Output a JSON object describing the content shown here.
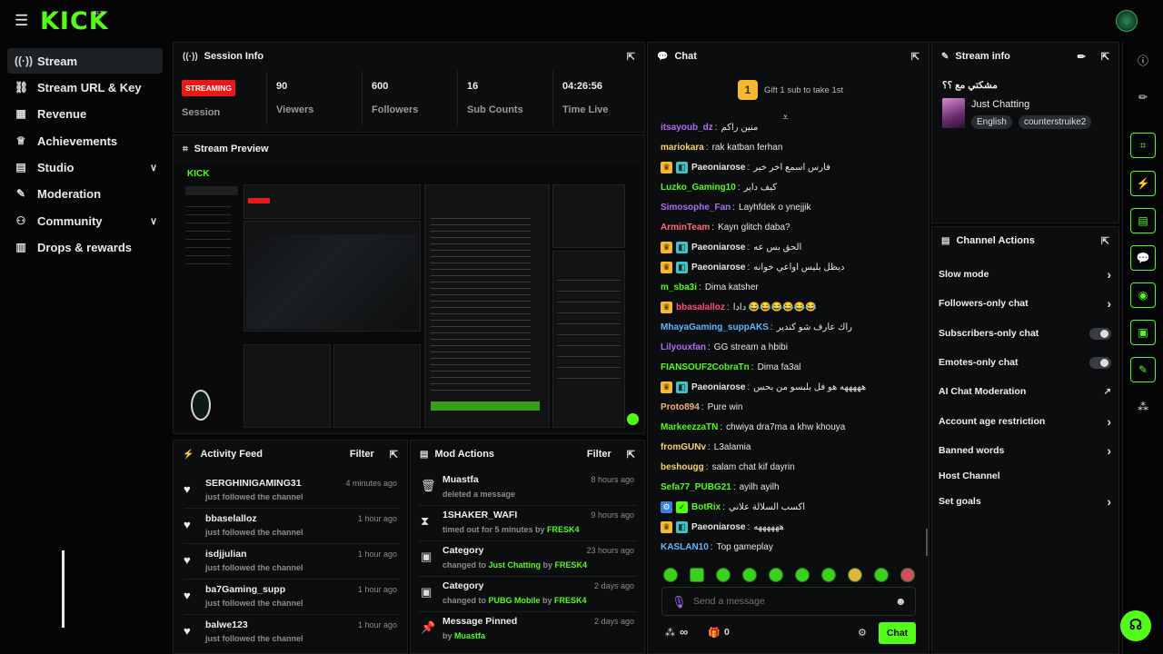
{
  "topbar": {
    "logo": "KICK",
    "beta": "BETA"
  },
  "sidebar": {
    "items": [
      {
        "label": "Stream",
        "icon": "broadcast-icon",
        "glyph": "((·))"
      },
      {
        "label": "Stream URL & Key",
        "icon": "link-icon",
        "glyph": "🔗"
      },
      {
        "label": "Revenue",
        "icon": "chart-icon",
        "glyph": "▦"
      },
      {
        "label": "Achievements",
        "icon": "trophy-icon",
        "glyph": "🏆"
      },
      {
        "label": "Studio",
        "icon": "studio-icon",
        "glyph": "▤"
      },
      {
        "label": "Moderation",
        "icon": "wrench-icon",
        "glyph": "🔧"
      },
      {
        "label": "Community",
        "icon": "people-icon",
        "glyph": "👥"
      },
      {
        "label": "Drops & rewards",
        "icon": "gift-icon",
        "glyph": "▥"
      }
    ]
  },
  "session": {
    "title": "Session Info",
    "status": "STREAMING",
    "session_label": "Session",
    "stats": [
      {
        "value": "90",
        "label": "Viewers"
      },
      {
        "value": "600",
        "label": "Followers"
      },
      {
        "value": "16",
        "label": "Sub Counts"
      },
      {
        "value": "04:26:56",
        "label": "Time Live"
      }
    ]
  },
  "preview": {
    "title": "Stream Preview"
  },
  "activity": {
    "title": "Activity Feed",
    "filter": "Filter",
    "items": [
      {
        "name": "SERGHINIGAMING31",
        "sub": "just followed the channel",
        "time": "4 minutes ago"
      },
      {
        "name": "bbaselalloz",
        "sub": "just followed the channel",
        "time": "1 hour ago"
      },
      {
        "name": "isdjjulian",
        "sub": "just followed the channel",
        "time": "1 hour ago"
      },
      {
        "name": "ba7Gaming_supp",
        "sub": "just followed the channel",
        "time": "1 hour ago"
      },
      {
        "name": "balwe123",
        "sub": "just followed the channel",
        "time": "1 hour ago"
      }
    ]
  },
  "mod": {
    "title": "Mod Actions",
    "filter": "Filter",
    "items": [
      {
        "name": "Muastfa",
        "pre": "deleted a message",
        "hl": "",
        "mid": "",
        "by": "",
        "time": "8 hours ago",
        "icon": "trash-icon",
        "glyph": "🗑"
      },
      {
        "name": "1SHAKER_WAFI",
        "pre": "timed out for 5 minutes by ",
        "hl": "FRESK4",
        "mid": "",
        "by": "",
        "time": "9 hours ago",
        "icon": "hourglass-icon",
        "glyph": "⌛"
      },
      {
        "name": "Category",
        "pre": "changed to ",
        "hl": "Just Chatting",
        "mid": " by ",
        "by": "FRESK4",
        "time": "23 hours ago",
        "icon": "category-icon",
        "glyph": "▣"
      },
      {
        "name": "Category",
        "pre": "changed to ",
        "hl": "PUBG Mobile",
        "mid": " by ",
        "by": "FRESK4",
        "time": "2 days ago",
        "icon": "category-icon",
        "glyph": "▣"
      },
      {
        "name": "Message Pinned",
        "pre": "by ",
        "hl": "Muastfa",
        "mid": "",
        "by": "",
        "time": "2 days ago",
        "icon": "pin-icon",
        "glyph": "📌"
      }
    ]
  },
  "chat": {
    "title": "Chat",
    "gift_count": "1",
    "gift_text": "Gift 1 sub to take 1st",
    "messages": [
      {
        "user": "itsayoub_dz",
        "color": "#b06cf5",
        "text": "منين راكم",
        "badges": []
      },
      {
        "user": "mariokara",
        "color": "#f5d36c",
        "text": "rak katban ferhan",
        "badges": []
      },
      {
        "user": "Paeoniarose",
        "color": "#e6e6e6",
        "text": "فارس اسمع اخر خبر",
        "badges": [
          "crown",
          "sub"
        ]
      },
      {
        "user": "Luzko_Gaming10",
        "color": "#53fc18",
        "text": "كيف داير",
        "badges": []
      },
      {
        "user": "Simosophe_Fan",
        "color": "#b06cf5",
        "text": "Layhfdek o ynejjik",
        "badges": []
      },
      {
        "user": "ArminTeam",
        "color": "#ff6b7a",
        "text": "Kayn glitch daba?",
        "badges": []
      },
      {
        "user": "Paeoniarose",
        "color": "#e6e6e6",
        "text": "الحق بس عه",
        "badges": [
          "crown",
          "sub"
        ]
      },
      {
        "user": "Paeoniarose",
        "color": "#e6e6e6",
        "text": "ديظل بليس اواعي خوانه",
        "badges": [
          "crown",
          "sub"
        ]
      },
      {
        "user": "m_sba3i",
        "color": "#53fc18",
        "text": "Dima katsher",
        "badges": []
      },
      {
        "user": "bbasalalloz",
        "color": "#ff4d7e",
        "text": "دادا 😂😂😂😂😂😂",
        "badges": [
          "crown"
        ]
      },
      {
        "user": "MhayaGaming_suppAKS",
        "color": "#5fb8ff",
        "text": "راك عارف شو كندير",
        "badges": []
      },
      {
        "user": "Lilyouxfan",
        "color": "#b06cf5",
        "text": "GG stream a hbibi",
        "badges": []
      },
      {
        "user": "FIANSOUF2CobraTn",
        "color": "#53fc18",
        "text": "Dima fa3al",
        "badges": []
      },
      {
        "user": "Paeoniarose",
        "color": "#e6e6e6",
        "text": "هههههه هو فل بلبسو من بحس",
        "badges": [
          "crown",
          "sub"
        ]
      },
      {
        "user": "Proto894",
        "color": "#f5b36c",
        "text": "Pure win",
        "badges": []
      },
      {
        "user": "MarkeezzaTN",
        "color": "#53fc18",
        "text": "chwiya dra7ma a khw khouya",
        "badges": []
      },
      {
        "user": "fromGUNv",
        "color": "#f5d36c",
        "text": "L3alamia",
        "badges": []
      },
      {
        "user": "beshougg",
        "color": "#f5d36c",
        "text": "salam chat kif dayrin",
        "badges": []
      },
      {
        "user": "Sefa77_PUBG21",
        "color": "#53fc18",
        "text": "ayilh ayilh",
        "badges": []
      },
      {
        "user": "BotRix",
        "color": "#53fc18",
        "text": "اكسب السلالة علاني",
        "badges": [
          "bot",
          "verified"
        ]
      },
      {
        "user": "Paeoniarose",
        "color": "#e6e6e6",
        "text": "ههههههه",
        "badges": [
          "crown",
          "sub"
        ]
      },
      {
        "user": "KASLAN10",
        "color": "#5fb8ff",
        "text": "Top gameplay",
        "badges": []
      }
    ],
    "placeholder": "Send a message",
    "points": "∞",
    "gift_inventory": "0",
    "send_label": "Chat"
  },
  "stream_info": {
    "title": "Stream info",
    "stream_title": "مشكتي مع ؟؟",
    "category": "Just Chatting",
    "tags": [
      "English",
      "counterstruike2"
    ]
  },
  "channel_actions": {
    "title": "Channel Actions",
    "items": [
      {
        "label": "Slow mode",
        "kind": "chevron"
      },
      {
        "label": "Followers-only chat",
        "kind": "chevron"
      },
      {
        "label": "Subscribers-only chat",
        "kind": "toggle"
      },
      {
        "label": "Emotes-only chat",
        "kind": "toggle"
      },
      {
        "label": "AI Chat Moderation",
        "kind": "external"
      },
      {
        "label": "Account age restriction",
        "kind": "chevron"
      },
      {
        "label": "Banned words",
        "kind": "chevron"
      },
      {
        "label": "Host Channel",
        "kind": "none"
      },
      {
        "label": "Set goals",
        "kind": "chevron"
      }
    ]
  },
  "rail": [
    "info-icon",
    "edit-icon",
    "scan-icon",
    "bolt-icon",
    "document-icon",
    "chat-bubble-icon",
    "broadcast-icon",
    "category-icon",
    "wrench-icon",
    "community-icon"
  ],
  "colors": {
    "accent": "#53fc18",
    "live": "#e91916"
  }
}
